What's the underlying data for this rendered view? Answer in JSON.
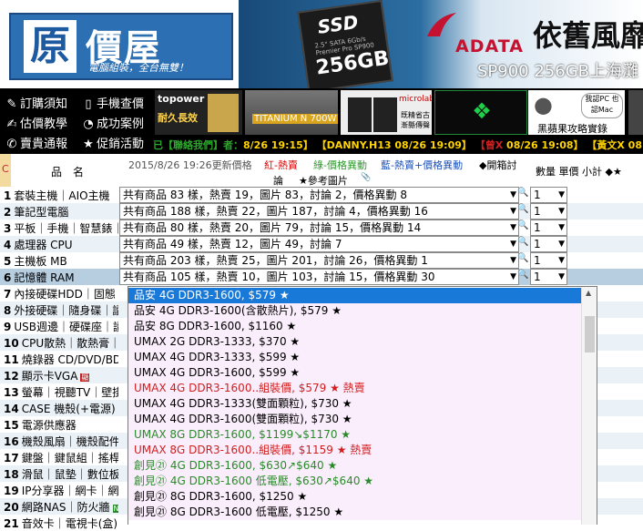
{
  "banner": {
    "logo_char": "原",
    "logo_text": "價屋",
    "slogan": "電腦組裝，全台無雙！",
    "ad": {
      "ssd_title": "SSD",
      "ssd_subtitle": "2.5\" SATA 6Gb/s  Premier Pro SP900",
      "ssd_capacity": "256GB",
      "brand": "ADATA",
      "headline": "依舊風靡",
      "model_line": "SP900 256GB上海灘"
    }
  },
  "nav": {
    "items": [
      {
        "icon": "✎",
        "label": "訂購須知"
      },
      {
        "icon": "▯",
        "label": "手機查價"
      },
      {
        "icon": "✍",
        "label": "估價教學"
      },
      {
        "icon": "◔",
        "label": "成功案例"
      },
      {
        "icon": "✆",
        "label": "賣貴通報"
      },
      {
        "icon": "★",
        "label": "促銷活動"
      }
    ]
  },
  "thumbs": {
    "t1_name": "topower",
    "t1_sub": "耐久長效",
    "t2_label": "TITANIUM N 700W",
    "t3_brand": "microlab",
    "t3_text": "既精省古 漸縣傳聲",
    "t5_bubble": "我認PC 也認Mac",
    "t5_label": "黑蘋果攻略實錄"
  },
  "ticker": [
    {
      "text": "已【聯絡我們】者：",
      "color": "#2ea62e"
    },
    {
      "text": "8/26 19:15】",
      "color": "#ffd400"
    },
    {
      "text": "【DANNY.H13 08/26 19:09】",
      "color": "#ffd400"
    },
    {
      "text": "【曾X",
      "color": "#d02020"
    },
    {
      "text": "08/26 19:08】",
      "color": "#ffd400"
    },
    {
      "text": "【黃文X 08",
      "color": "#ffd400"
    }
  ],
  "list_header": {
    "c_label": "C",
    "name_label": "品名",
    "updated": "2015/8/26 19:26更新價格",
    "legend_red": "紅-熱賣",
    "legend_green": "綠-價格異動",
    "legend_blue": "藍-熱賣+價格異動",
    "legend_open": "◆開箱討",
    "legend_disc": "論",
    "legend_ref": "★參考圖片",
    "legend_pics": "📎",
    "cols": "數量 單價 小計 ◆★"
  },
  "categories": [
    {
      "num": "1",
      "name": "套裝主機｜AIO主機",
      "summary": "共有商品 83 樣，熱賣 19，圖片 83，討論 2，價格異動 8",
      "qty": "1"
    },
    {
      "num": "2",
      "name": "筆記型電腦",
      "summary": "共有商品 188 樣，熱賣 22，圖片 187，討論 4，價格異動 16",
      "qty": "1"
    },
    {
      "num": "3",
      "name": "平板｜手機｜智慧錶｜",
      "summary": "共有商品 80 樣，熱賣 20，圖片 79，討論 15，價格異動 14",
      "qty": "1"
    },
    {
      "num": "4",
      "name": "處理器 CPU",
      "summary": "共有商品 49 樣，熱賣 12，圖片 49，討論 7",
      "qty": "1"
    },
    {
      "num": "5",
      "name": "主機板 MB",
      "summary": "共有商品 203 樣，熱賣 25，圖片 201，討論 26，價格異動 1",
      "qty": "1"
    },
    {
      "num": "6",
      "name": "記憶體 RAM",
      "summary": "共有商品 105 樣，熱賣 10，圖片 103，討論 15，價格異動 30",
      "qty": "1"
    },
    {
      "num": "7",
      "name": "內接硬碟HDD｜固態"
    },
    {
      "num": "8",
      "name": "外接硬碟｜隨身碟｜讀"
    },
    {
      "num": "9",
      "name": "USB週邊｜硬碟座｜讀"
    },
    {
      "num": "10",
      "name": "CPU散熱｜散熱膏｜散"
    },
    {
      "num": "11",
      "name": "燒錄器 CD/DVD/BD"
    },
    {
      "num": "12",
      "name": "顯示卡VGA",
      "badge": "顯"
    },
    {
      "num": "13",
      "name": "螢幕｜視聽TV｜壁掛架"
    },
    {
      "num": "14",
      "name": "CASE 機殼(+電源)"
    },
    {
      "num": "15",
      "name": "電源供應器"
    },
    {
      "num": "16",
      "name": "機殼風扇｜機殼配件"
    },
    {
      "num": "17",
      "name": "鍵盤｜鍵鼠組｜搖桿"
    },
    {
      "num": "18",
      "name": "滑鼠｜鼠墊｜數位板"
    },
    {
      "num": "19",
      "name": "IP分享器｜網卡｜網通"
    },
    {
      "num": "20",
      "name": "網路NAS｜防火牆",
      "badge": "NAS"
    },
    {
      "num": "21",
      "name": "音效卡｜電視卡(盒)｜"
    }
  ],
  "dropdown": {
    "options": [
      {
        "text": "品安 4G DDR3-1600, $579 ★",
        "style": "hl"
      },
      {
        "text": "品安 4G DDR3-1600(含散熱片), $579 ★",
        "style": "pink"
      },
      {
        "text": "品安 8G DDR3-1600, $1160 ★",
        "style": "pink"
      },
      {
        "text": "UMAX 2G DDR3-1333, $370 ★",
        "style": "pink"
      },
      {
        "text": "UMAX 4G DDR3-1333, $599 ★",
        "style": "pink"
      },
      {
        "text": "UMAX 4G DDR3-1600, $599 ★",
        "style": "pink"
      },
      {
        "text": "UMAX 4G DDR3-1600..組裝價, $579 ★ 熱賣",
        "style": "pink red"
      },
      {
        "text": "UMAX 4G DDR3-1333(雙面顆粒), $730 ★",
        "style": "pink"
      },
      {
        "text": "UMAX 4G DDR3-1600(雙面顆粒), $730 ★",
        "style": "pink"
      },
      {
        "text": "UMAX 8G DDR3-1600, $1199↘$1170 ★",
        "style": "pink green"
      },
      {
        "text": "UMAX 8G DDR3-1600..組裝價, $1159 ★ 熱賣",
        "style": "pink red"
      },
      {
        "text": "創見㉑ 4G DDR3-1600, $630↗$640 ★",
        "style": "pink green"
      },
      {
        "text": "創見㉑ 4G DDR3-1600 低電壓, $630↗$640 ★",
        "style": "pink green"
      },
      {
        "text": "創見㉑ 8G DDR3-1600, $1250 ★",
        "style": "pink"
      },
      {
        "text": "創見㉑ 8G DDR3-1600 低電壓, $1250 ★",
        "style": "pink"
      }
    ]
  },
  "colors": {
    "brand_blue": "#2c6fb2",
    "highlight": "#1979d8",
    "hot_red": "#d01e1e",
    "change_green": "#2a8a2a",
    "selected_row": "#b7cde0"
  }
}
